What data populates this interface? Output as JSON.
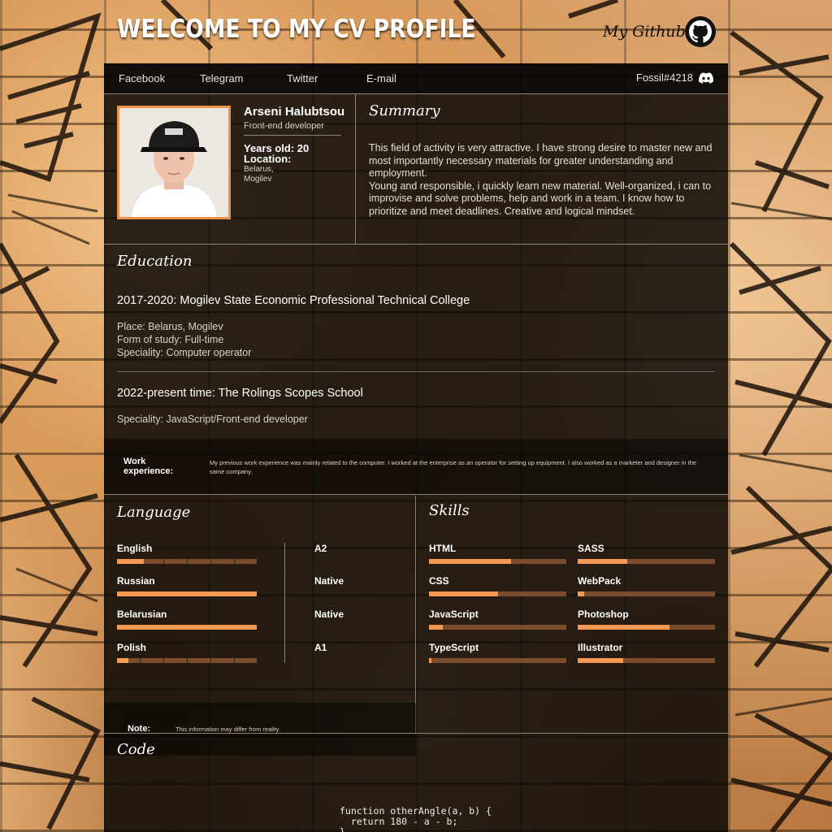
{
  "header": {
    "title": "WELCOME TO MY CV PROFILE",
    "github_label": "My Github",
    "github_icon": "github-icon"
  },
  "nav": {
    "links": [
      "Facebook",
      "Telegram",
      "Twitter",
      "E-mail"
    ],
    "discord_tag": "Fossil#4218",
    "discord_icon": "discord-icon"
  },
  "profile": {
    "name": "Arseni Halubtsou",
    "role": "Front-end developer",
    "age": "Years old: 20",
    "location_label": "Location:",
    "location_country": "Belarus,",
    "location_city": "Mogilev"
  },
  "summary": {
    "title": "Summary",
    "text": "This field of activity is very attractive. I have strong desire to master new and most importantly necessary materials for greater understanding and employment.\nYoung and responsible, i quickly learn new material. Well-organized, i can to improvise and solve problems, help and work in a team. I know how to prioritize and meet deadlines. Creative and logical mindset."
  },
  "education": {
    "title": "Education",
    "entries": [
      {
        "heading": "2017-2020: Mogilev State Economic Professional Technical College",
        "lines": [
          "Place: Belarus, Mogilev",
          "Form of study: Full-time",
          "Speciality: Computer operator"
        ]
      },
      {
        "heading": "2022-present time: The Rolings Scopes School",
        "lines": [
          "Speciality: JavaScript/Front-end developer"
        ]
      }
    ]
  },
  "work": {
    "label": "Work experience:",
    "text": "My previous work experience was mainly related to the computer. I worked at the enterprise as an operator for setting up equipment. I also worked as a marketer and designer in the same company."
  },
  "languages": {
    "title": "Language",
    "items": [
      {
        "name": "English",
        "level": "A2",
        "fill": 0.19
      },
      {
        "name": "Russian",
        "level": "Native",
        "fill": 1.0
      },
      {
        "name": "Belarusian",
        "level": "Native",
        "fill": 1.0
      },
      {
        "name": "Polish",
        "level": "A1",
        "fill": 0.08
      }
    ],
    "note_label": "Note:",
    "note_text": "This information may differ from reality."
  },
  "skills": {
    "title": "Skills",
    "items": [
      {
        "name": "HTML",
        "fill": 0.6
      },
      {
        "name": "SASS",
        "fill": 0.36
      },
      {
        "name": "CSS",
        "fill": 0.5
      },
      {
        "name": "WebPack",
        "fill": 0.05
      },
      {
        "name": "JavaScript",
        "fill": 0.1
      },
      {
        "name": "Photoshop",
        "fill": 0.67
      },
      {
        "name": "TypeScript",
        "fill": 0.02
      },
      {
        "name": "Illustrator",
        "fill": 0.33
      }
    ]
  },
  "code": {
    "title": "Code",
    "snippet": "function otherAngle(a, b) {\n  return 180 - a - b;\n}"
  },
  "colors": {
    "accent": "#f59a55",
    "bar_track": "#7a4e2c",
    "card_bg": "#0a0806"
  }
}
